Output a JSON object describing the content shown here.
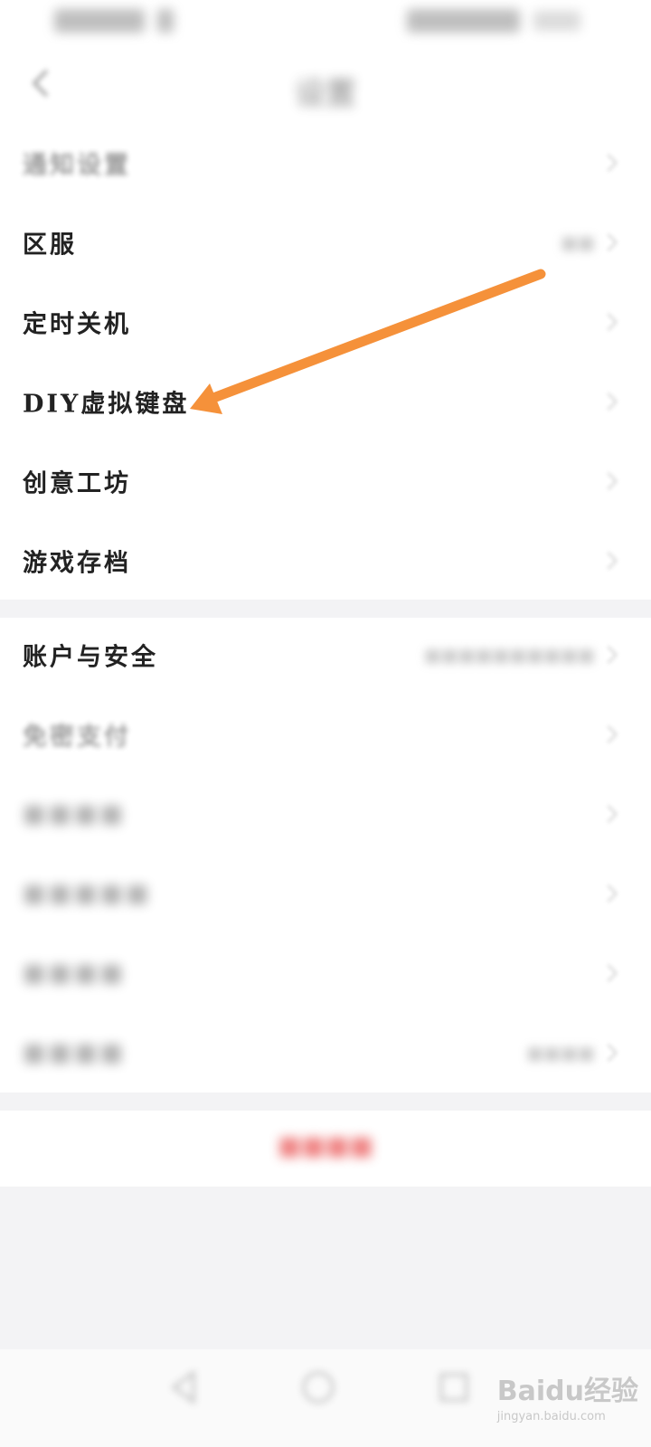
{
  "status_bar": {
    "left_text": "■■■■ ▯",
    "right_text": "■■■■■ ■■■"
  },
  "header": {
    "title": "设置",
    "back_icon": "chevron-left-icon"
  },
  "section1": [
    {
      "label": "通知设置",
      "value": "",
      "blur": "blur"
    },
    {
      "label": "区服",
      "value": "■■",
      "blur": ""
    },
    {
      "label": "定时关机",
      "value": "",
      "blur": ""
    },
    {
      "label": "DIY虚拟键盘",
      "value": "",
      "blur": ""
    },
    {
      "label": "创意工坊",
      "value": "",
      "blur": ""
    },
    {
      "label": "游戏存档",
      "value": "",
      "blur": ""
    }
  ],
  "section2": [
    {
      "label": "账户与安全",
      "value": "■■■■■■■■■■",
      "blur": ""
    },
    {
      "label": "免密支付",
      "value": "",
      "blur": "blur"
    },
    {
      "label": "■■■■",
      "value": "",
      "blur": "blur2"
    },
    {
      "label": "■■■■■",
      "value": "",
      "blur": "blur2"
    },
    {
      "label": "■■■■",
      "value": "",
      "blur": "blur2"
    },
    {
      "label": "■■■■",
      "value": "■■■■",
      "blur": "blur2"
    }
  ],
  "logout_label": "■■■■",
  "watermark": {
    "main": "Baidu经验",
    "sub": "jingyan.baidu.com"
  },
  "annotation": {
    "arrow_color": "#f5913a"
  },
  "colors": {
    "accent_red": "#e84b4b",
    "divider": "#f3f3f5"
  }
}
